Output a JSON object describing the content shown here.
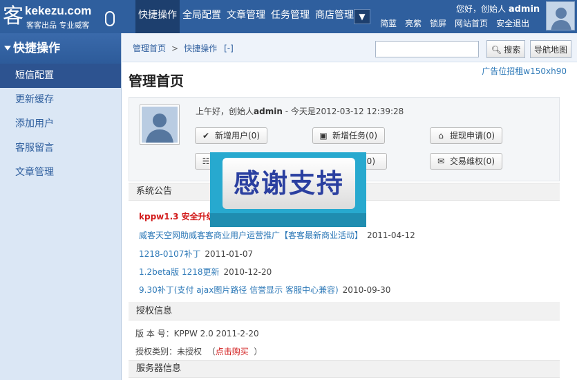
{
  "header": {
    "logo_text": "kekezu.com",
    "logo_char": "客",
    "slogan": "客客出品 专业威客",
    "nav": [
      "快捷操作",
      "全局配置",
      "文章管理",
      "任务管理",
      "商店管理"
    ],
    "nav_more": "▼",
    "greeting_prefix": "您好，创始人",
    "username": "admin",
    "links": [
      "简蓝",
      "亮紫",
      "锁屏",
      "网站首页",
      "安全退出"
    ]
  },
  "sidebar": {
    "title": "快捷操作",
    "items": [
      "短信配置",
      "更新缓存",
      "添加用户",
      "客服留言",
      "文章管理"
    ]
  },
  "breadcrumb": {
    "home": "管理首页",
    "current": "快捷操作",
    "collapse": "[-]"
  },
  "search": {
    "value": "",
    "button": "搜索",
    "sitemap": "导航地图"
  },
  "ad_slot": "广告位招租w150xh90",
  "page_title": "管理首页",
  "welcome": {
    "prefix": "上午好，创始人",
    "username": "admin",
    "suffix": " - 今天是2012-03-12 12:39:28"
  },
  "quick_buttons": [
    {
      "label": "新增用户(0)",
      "icon": "check-icon"
    },
    {
      "label": "新增任务(0)",
      "icon": "document-icon"
    },
    {
      "label": "提现申请(0)",
      "icon": "home-icon"
    },
    {
      "label": "",
      "icon": "rss-icon"
    },
    {
      "label": "(0)",
      "icon": "none"
    },
    {
      "label": "交易维权(0)",
      "icon": "envelope-icon"
    }
  ],
  "announcements": {
    "title": "系统公告",
    "items": [
      {
        "text": "kppw1.3 安全升级",
        "date": "",
        "hot": true
      },
      {
        "text": "威客天空网助威客客商业用户运营推广【客客最新商业活动】",
        "date": "2011-04-12",
        "hot": false
      },
      {
        "text": "1218-0107补丁",
        "date": "2011-01-07",
        "hot": false
      },
      {
        "text": "1.2beta版 1218更新",
        "date": "2010-12-20",
        "hot": false
      },
      {
        "text": "9.30补丁(支付 ajax图片路径 信誉显示 客服中心兼容)",
        "date": "2010-09-30",
        "hot": false
      }
    ]
  },
  "license": {
    "title": "授权信息",
    "version_label": "版 本 号：",
    "version": "KPPW 2.0 2011-2-20",
    "type_label": "授权类别：",
    "type": "未授权",
    "open": "（",
    "buy": "点击购买",
    "close": "）"
  },
  "server": {
    "title": "服务器信息"
  },
  "overlay_text": "感谢支持",
  "colors": {
    "header": "#2f5f9e",
    "sidebar_bg": "#dbe7f5",
    "active": "#2d5390",
    "link": "#2f7ab8",
    "hot": "#d21b1b",
    "overlay": "#27a9cf"
  }
}
